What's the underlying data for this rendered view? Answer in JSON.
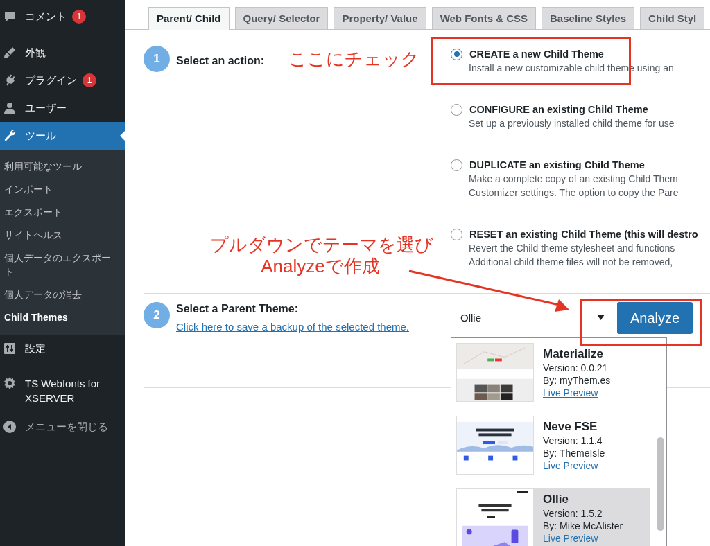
{
  "sidebar": {
    "items": [
      {
        "label": "コメント",
        "badge": "1",
        "selected": false
      },
      {
        "label": "外観",
        "selected": false
      },
      {
        "label": "プラグイン",
        "badge": "1",
        "selected": false
      },
      {
        "label": "ユーザー",
        "selected": false
      },
      {
        "label": "ツール",
        "selected": true,
        "children": [
          {
            "label": "利用可能なツール",
            "selected": false
          },
          {
            "label": "インポート",
            "selected": false
          },
          {
            "label": "エクスポート",
            "selected": false
          },
          {
            "label": "サイトヘルス",
            "selected": false
          },
          {
            "label": "個人データのエクスポート",
            "selected": false
          },
          {
            "label": "個人データの消去",
            "selected": false
          },
          {
            "label": "Child Themes",
            "selected": true
          }
        ]
      },
      {
        "label": "設定",
        "selected": false
      },
      {
        "label": "TS Webfonts for XSERVER",
        "selected": false
      }
    ],
    "collapse_menu": "メニューを閉じる"
  },
  "tabs": [
    {
      "label": "Parent/ Child",
      "selected": true
    },
    {
      "label": "Query/ Selector",
      "selected": false
    },
    {
      "label": "Property/ Value",
      "selected": false
    },
    {
      "label": "Web Fonts & CSS",
      "selected": false
    },
    {
      "label": "Baseline Styles",
      "selected": false
    },
    {
      "label": "Child Styl",
      "selected": false
    }
  ],
  "step_1": {
    "number": "1",
    "label": "Select an action:",
    "options": [
      {
        "title": "CREATE a new Child Theme",
        "description": [
          "Install a new customizable child theme using an"
        ],
        "selected": true
      },
      {
        "title": "CONFIGURE an existing Child Theme",
        "description": [
          "Set up a previously installed child theme for use"
        ],
        "selected": false
      },
      {
        "title": "DUPLICATE an existing Child Theme",
        "description": [
          "Make a complete copy of an existing Child Them",
          "Customizer settings. The option to copy the Pare"
        ],
        "selected": false
      },
      {
        "title": "RESET an existing Child Theme (this will destro",
        "description": [
          "Revert the Child theme stylesheet and functions",
          "Additional child theme files will not be removed,"
        ],
        "selected": false
      }
    ]
  },
  "step_2": {
    "number": "2",
    "label": "Select a Parent Theme:",
    "link": "Click here to save a backup of the selected theme.",
    "select": {
      "value": "Ollie"
    },
    "button": "Analyze",
    "themes": [
      {
        "name": "Materialize",
        "version": "Version: 0.0.21",
        "author": "By: myThem.es",
        "link": "Live Preview",
        "selected": false
      },
      {
        "name": "Neve FSE",
        "version": "Version: 1.1.4",
        "author": "By: ThemeIsle",
        "link": "Live Preview",
        "selected": false
      },
      {
        "name": "Ollie",
        "version": "Version: 1.5.2",
        "author": "By: Mike McAlister",
        "link": "Live Preview",
        "selected": true
      }
    ]
  },
  "annotations": [
    {
      "lines": [
        "ここにチェック"
      ]
    },
    {
      "lines": [
        "プルダウンでテーマを選び",
        "Analyzeで作成"
      ]
    }
  ]
}
